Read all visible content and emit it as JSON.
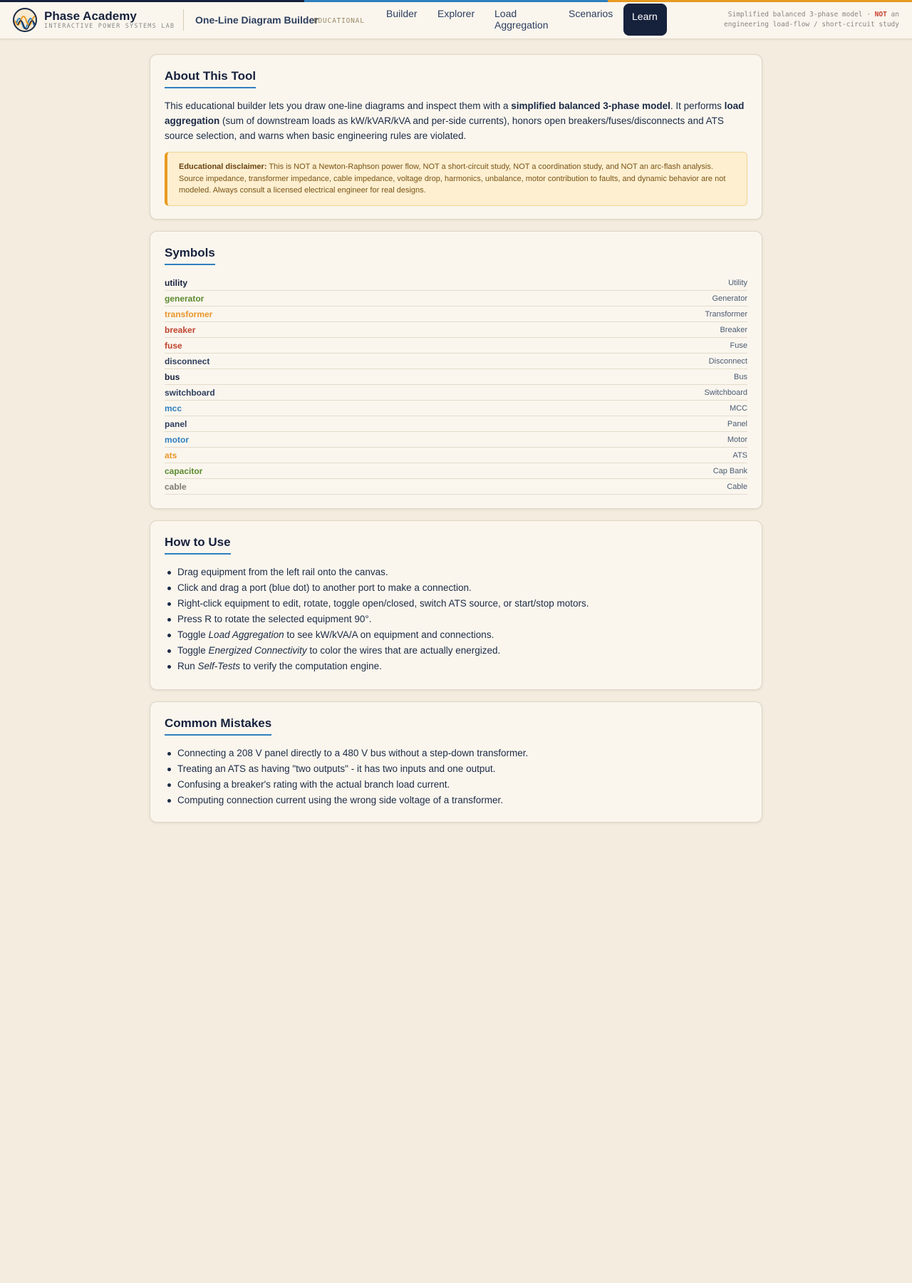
{
  "header": {
    "brand_name": "Phase Academy",
    "brand_sub": "INTERACTIVE POWER SYSTEMS LAB",
    "tool_title": "One-Line Diagram Builder",
    "tool_badge": "EDUCATIONAL",
    "nav": [
      {
        "label": "Builder",
        "active": false
      },
      {
        "label": "Explorer",
        "active": false
      },
      {
        "label": "Load Aggregation",
        "active": false
      },
      {
        "label": "Scenarios",
        "active": false
      },
      {
        "label": "Learn",
        "active": true
      }
    ],
    "disclaimer_a": "Simplified balanced 3-phase model · ",
    "disclaimer_not": "NOT",
    "disclaimer_b": " an engineering load-flow / short-circuit study"
  },
  "about": {
    "title": "About This Tool",
    "p1": "This educational builder lets you draw one-line diagrams and inspect them with a ",
    "p1_bold": "simplified balanced 3-phase model",
    "p2": ". It performs ",
    "p2_bold": "load aggregation",
    "p3": " (sum of downstream loads as kW/kVAR/kVA and per-side currents), honors open breakers/fuses/disconnects and ATS source selection, and warns when basic engineering rules are violated.",
    "warn_label": "Educational disclaimer:",
    "warn_text": " This is NOT a Newton-Raphson power flow, NOT a short-circuit study, NOT a coordination study, and NOT an arc-flash analysis. Source impedance, transformer impedance, cable impedance, voltage drop, harmonics, unbalance, motor contribution to faults, and dynamic behavior are not modeled. Always consult a licensed electrical engineer for real designs."
  },
  "symbols": {
    "title": "Symbols",
    "items": [
      {
        "key": "utility",
        "label": "Utility",
        "color": "#16213c"
      },
      {
        "key": "generator",
        "label": "Generator",
        "color": "#5b8a2e"
      },
      {
        "key": "transformer",
        "label": "Transformer",
        "color": "#e8962a"
      },
      {
        "key": "breaker",
        "label": "Breaker",
        "color": "#c0432f"
      },
      {
        "key": "fuse",
        "label": "Fuse",
        "color": "#c0432f"
      },
      {
        "key": "disconnect",
        "label": "Disconnect",
        "color": "#2d3e5e"
      },
      {
        "key": "bus",
        "label": "Bus",
        "color": "#16213c"
      },
      {
        "key": "switchboard",
        "label": "Switchboard",
        "color": "#2d3e5e"
      },
      {
        "key": "mcc",
        "label": "MCC",
        "color": "#2f7fbf"
      },
      {
        "key": "panel",
        "label": "Panel",
        "color": "#2d3e5e"
      },
      {
        "key": "motor",
        "label": "Motor",
        "color": "#2f7fbf"
      },
      {
        "key": "ats",
        "label": "ATS",
        "color": "#e8962a"
      },
      {
        "key": "capacitor",
        "label": "Cap Bank",
        "color": "#5b8a2e"
      },
      {
        "key": "cable",
        "label": "Cable",
        "color": "#7d7a72"
      }
    ]
  },
  "howto": {
    "title": "How to Use",
    "items": [
      {
        "a": "Drag equipment from the left rail onto the canvas.",
        "em": "",
        "b": ""
      },
      {
        "a": "Click and drag a port (blue dot) to another port to make a connection.",
        "em": "",
        "b": ""
      },
      {
        "a": "Right-click equipment to edit, rotate, toggle open/closed, switch ATS source, or start/stop motors.",
        "em": "",
        "b": ""
      },
      {
        "a": "Press R to rotate the selected equipment 90°.",
        "em": "",
        "b": ""
      },
      {
        "a": "Toggle ",
        "em": "Load Aggregation",
        "b": " to see kW/kVA/A on equipment and connections."
      },
      {
        "a": "Toggle ",
        "em": "Energized Connectivity",
        "b": " to color the wires that are actually energized."
      },
      {
        "a": "Run ",
        "em": "Self-Tests",
        "b": " to verify the computation engine."
      }
    ]
  },
  "mistakes": {
    "title": "Common Mistakes",
    "items": [
      "Connecting a 208 V panel directly to a 480 V bus without a step-down transformer.",
      "Treating an ATS as having \"two outputs\" - it has two inputs and one output.",
      "Confusing a breaker's rating with the actual branch load current.",
      "Computing connection current using the wrong side voltage of a transformer."
    ]
  }
}
